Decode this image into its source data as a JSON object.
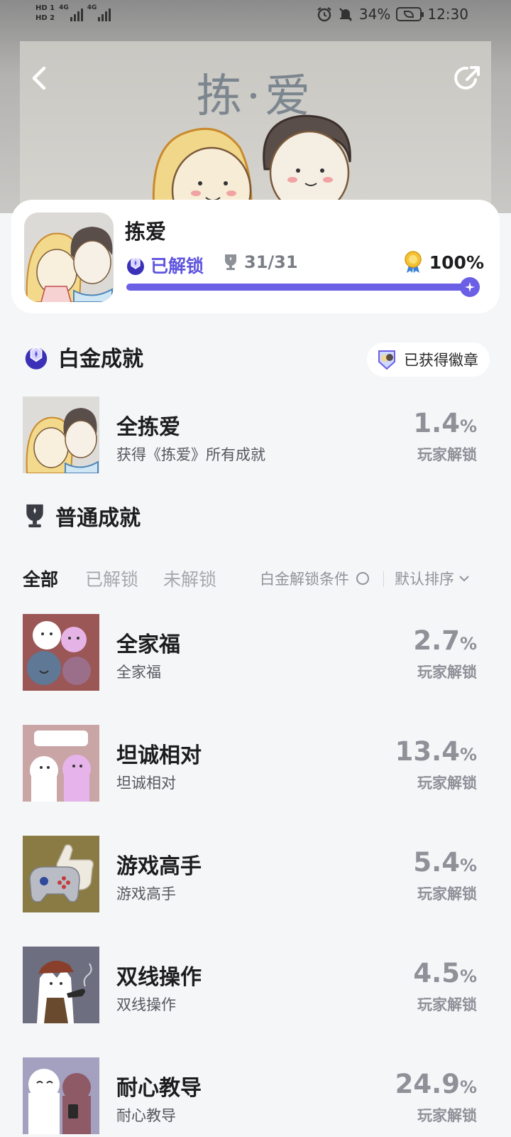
{
  "status_bar": {
    "hd1": "HD 1",
    "hd2": "HD 2",
    "network1": "4G",
    "network2": "4G",
    "battery_percent": "34%",
    "time": "12:30"
  },
  "hero": {
    "title": "拣·爱"
  },
  "game": {
    "title": "拣爱",
    "unlock_status": "已解锁",
    "trophy_count": "31/31",
    "completion": "100%",
    "progress": 1.0
  },
  "platinum": {
    "section_title": "白金成就",
    "badge_label": "已获得徽章",
    "achievement": {
      "name": "全拣爱",
      "description": "获得《拣爱》所有成就",
      "percent": "1.4",
      "percent_unit": "%",
      "label": "玩家解锁"
    }
  },
  "normal": {
    "section_title": "普通成就",
    "filters": {
      "all": "全部",
      "unlocked": "已解锁",
      "locked": "未解锁",
      "condition": "白金解锁条件",
      "sort": "默认排序"
    },
    "achievements": [
      {
        "name": "全家福",
        "description": "全家福",
        "percent": "2.7",
        "percent_unit": "%",
        "label": "玩家解锁"
      },
      {
        "name": "坦诚相对",
        "description": "坦诚相对",
        "percent": "13.4",
        "percent_unit": "%",
        "label": "玩家解锁"
      },
      {
        "name": "游戏高手",
        "description": "游戏高手",
        "percent": "5.4",
        "percent_unit": "%",
        "label": "玩家解锁"
      },
      {
        "name": "双线操作",
        "description": "双线操作",
        "percent": "4.5",
        "percent_unit": "%",
        "label": "玩家解锁"
      },
      {
        "name": "耐心教导",
        "description": "耐心教导",
        "percent": "24.9",
        "percent_unit": "%",
        "label": "玩家解锁"
      }
    ]
  },
  "colors": {
    "accent": "#6b5fe6",
    "accent_text": "#5f55df",
    "page_bg": "#f5f6f8",
    "muted": "#8e9198"
  },
  "icons": {
    "back": "back-arrow-icon",
    "share": "share-icon",
    "platinum": "platinum-trophy-icon",
    "trophy": "trophy-icon",
    "medal": "medal-icon",
    "badge": "badge-icon",
    "sort": "chevron-down-icon"
  }
}
